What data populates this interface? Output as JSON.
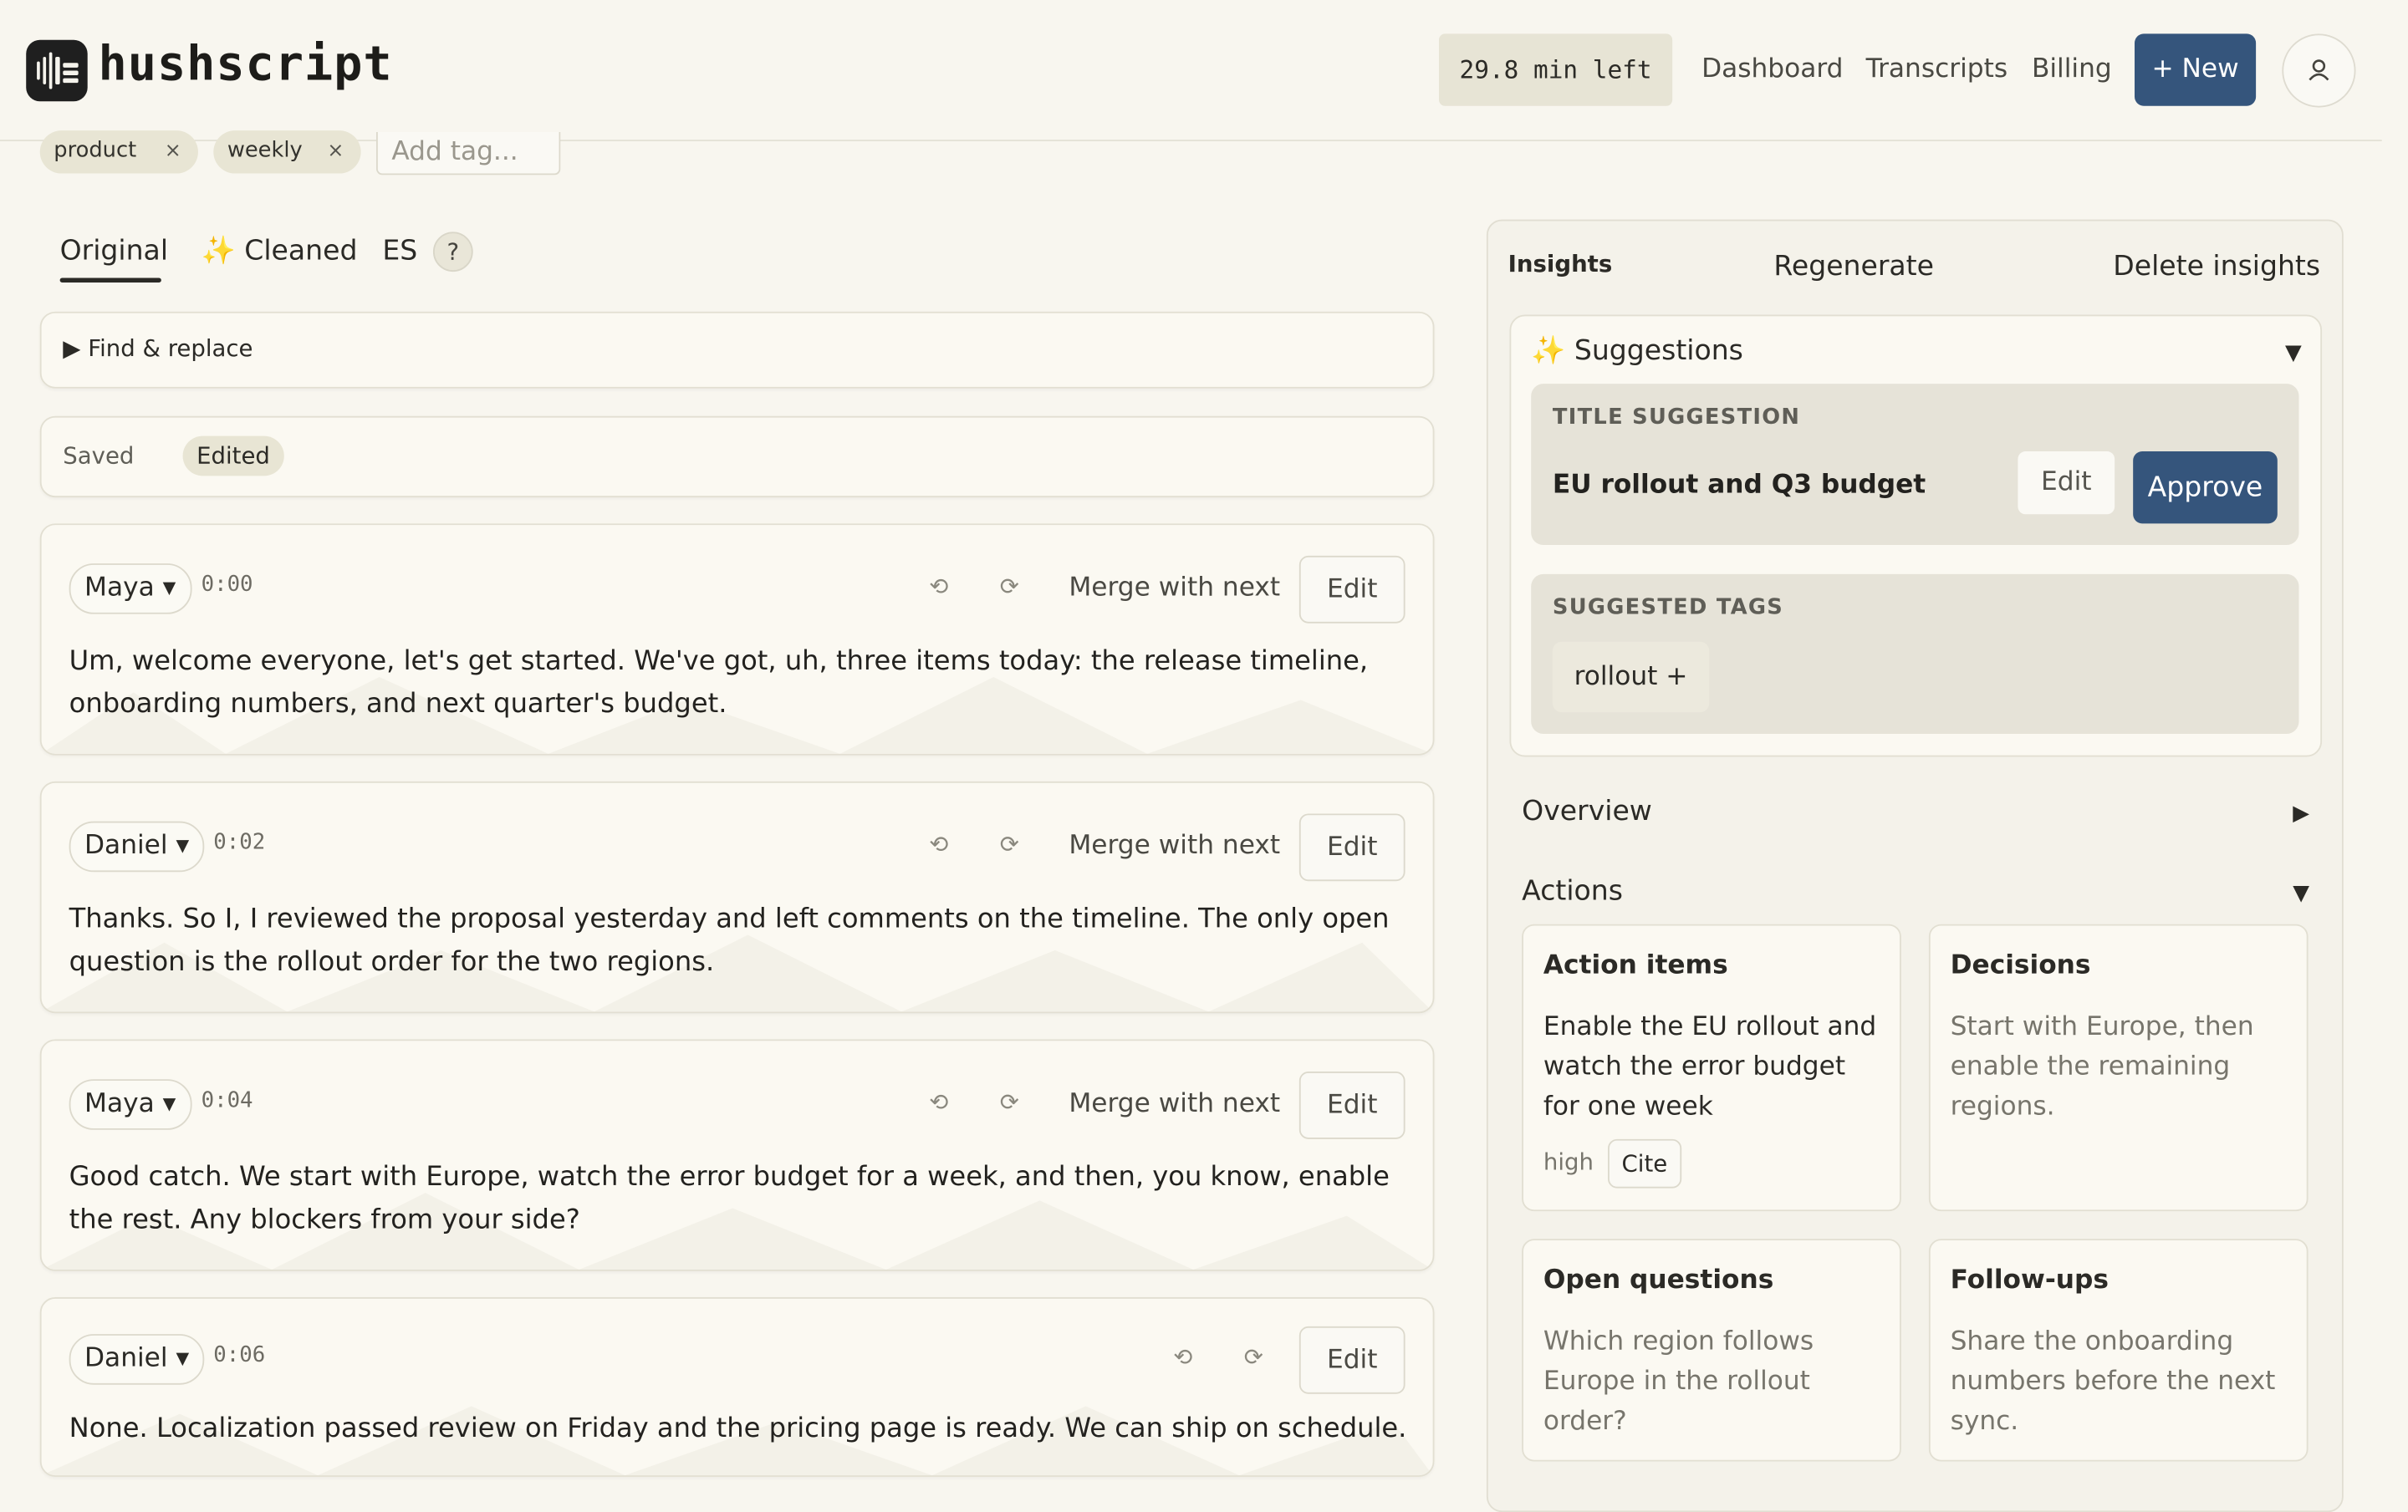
{
  "header": {
    "logo_text": "hushscript",
    "minutes_left": "29.8 min left",
    "nav": [
      "Dashboard",
      "Transcripts",
      "Billing"
    ],
    "new_label": "+ New"
  },
  "tags": {
    "items": [
      {
        "label": "product",
        "remove": "×"
      },
      {
        "label": "weekly",
        "remove": "×"
      }
    ],
    "placeholder": "Add tag..."
  },
  "tabs": {
    "original": "Original",
    "cleaned": "✨ Cleaned",
    "language": "ES",
    "help": "?"
  },
  "find_replace": {
    "label": "▶ Find & replace"
  },
  "status": {
    "saved": "Saved",
    "edited": "Edited"
  },
  "segments": [
    {
      "speaker": "Maya ▾",
      "time": "0:00",
      "merge": "Merge with next",
      "edit": "Edit",
      "text": "Um, welcome everyone, let's get started. We've got, uh, three items today: the release timeline, onboarding numbers, and next quarter's budget."
    },
    {
      "speaker": "Daniel ▾",
      "time": "0:02",
      "merge": "Merge with next",
      "edit": "Edit",
      "text": "Thanks. So I, I reviewed the proposal yesterday and left comments on the timeline. The only open question is the rollout order for the two regions."
    },
    {
      "speaker": "Maya ▾",
      "time": "0:04",
      "merge": "Merge with next",
      "edit": "Edit",
      "text": "Good catch. We start with Europe, watch the error budget for a week, and then, you know, enable the rest. Any blockers from your side?"
    },
    {
      "speaker": "Daniel ▾",
      "time": "0:06",
      "merge": "",
      "edit": "Edit",
      "text": "None. Localization passed review on Friday and the pricing page is ready. We can ship on schedule."
    }
  ],
  "insights": {
    "title": "Insights",
    "regenerate": "Regenerate",
    "delete": "Delete insights",
    "suggestions": {
      "title": "✨ Suggestions",
      "title_suggestion_heading": "TITLE SUGGESTION",
      "title_suggestion": "EU rollout and Q3 budget",
      "edit": "Edit",
      "approve": "Approve",
      "tags_heading": "SUGGESTED TAGS",
      "tag": "rollout +"
    },
    "overview": "Overview",
    "actions": "Actions",
    "cards": {
      "action_items": {
        "title": "Action items",
        "body": "Enable the EU rollout and watch the error budget for one week",
        "priority": "high",
        "cite": "Cite"
      },
      "decisions": {
        "title": "Decisions",
        "body": "Start with Europe, then enable the remaining regions."
      },
      "open_questions": {
        "title": "Open questions",
        "body": "Which region follows Europe in the rollout order?"
      },
      "follow_ups": {
        "title": "Follow-ups",
        "body": "Share the onboarding numbers before the next sync."
      }
    }
  },
  "colors": {
    "accent": "#35557c",
    "background": "#f8f6ef",
    "chip": "#e8e5d4"
  }
}
